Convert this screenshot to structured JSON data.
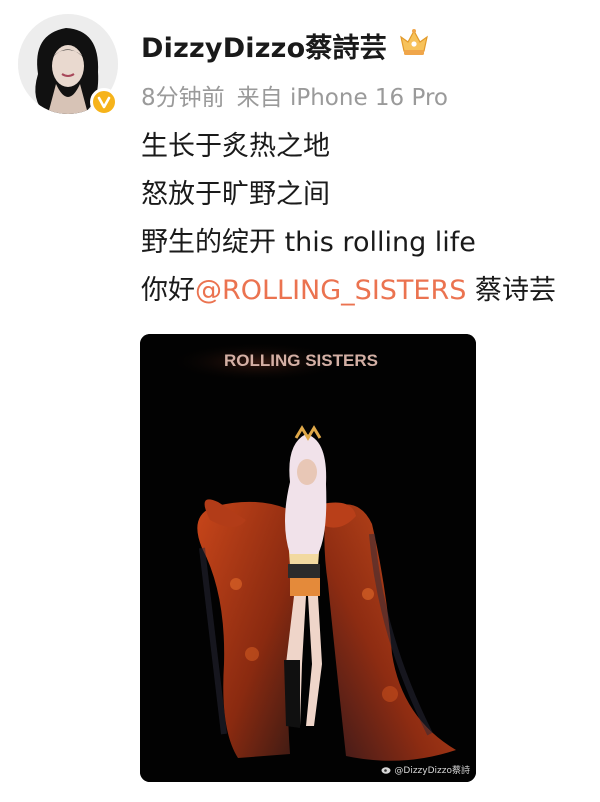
{
  "post": {
    "username": "DizzyDizzo蔡詩芸",
    "time": "8分钟前",
    "source": "来自 iPhone 16 Pro",
    "lines": [
      "生长于炙热之地",
      "怒放于旷野之间",
      "野生的绽开 this rolling life"
    ],
    "line4_prefix": "你好",
    "mention": "@ROLLING_SISTERS",
    "line4_suffix": " 蔡诗芸"
  },
  "image": {
    "poster_title": "ROLLING SISTERS",
    "watermark": "@DizzyDizzo蔡詩"
  },
  "colors": {
    "mention": "#eb7350",
    "verified": "#f6b31a",
    "meta": "#9a9a9a"
  },
  "icons": {
    "verified": "verified-badge-icon",
    "crown": "crown-icon",
    "weibo": "weibo-logo-icon"
  }
}
